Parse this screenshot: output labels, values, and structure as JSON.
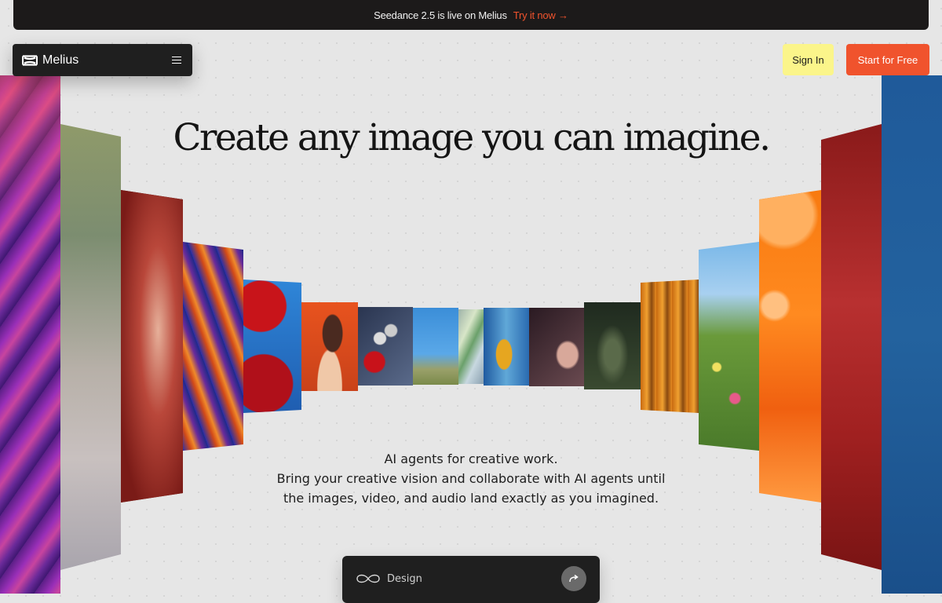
{
  "announcement": {
    "text": "Seedance 2.5 is live on Melius",
    "cta": "Try it now →"
  },
  "nav": {
    "logo_text": "Melius",
    "menu_icon": "hamburger-menu-icon",
    "signin_label": "Sign In",
    "start_label": "Start for Free"
  },
  "hero": {
    "headline": "Create any image you can imagine.",
    "subtitle_line1": "AI agents for creative work.",
    "subtitle_line2": "Bring your creative vision and collaborate with AI agents until the images, video, and audio land exactly as you imagined."
  },
  "prompt": {
    "placeholder": "Design",
    "mode_icon": "infinity-icon",
    "send_icon": "send-arrow-icon"
  },
  "colors": {
    "accent": "#f0532d",
    "signin_bg": "#fbf58a",
    "dark": "#1f1f1f",
    "page_bg": "#e6e6e6"
  }
}
